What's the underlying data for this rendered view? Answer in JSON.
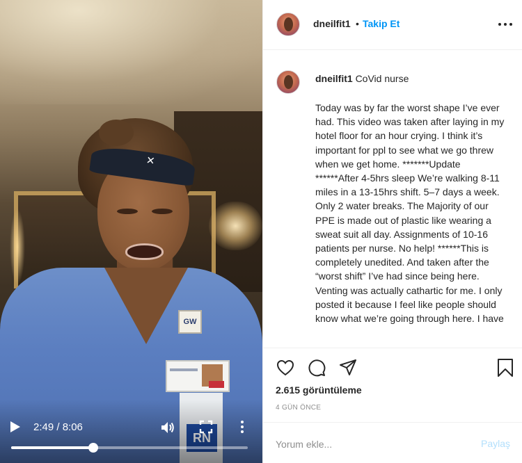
{
  "video": {
    "headband_logo": "✕",
    "lanyard_clip_text": "GW",
    "badge_tag_text": "RN",
    "time_display": "2:49 / 8:06",
    "progress_fraction": 0.348
  },
  "header": {
    "username": "dneilfit1",
    "separator": "•",
    "follow_label": "Takip Et"
  },
  "caption": {
    "username": "dneilfit1",
    "short_text": "CoVid nurse",
    "body": "Today was by far the worst shape I’ve ever had. This video was taken after laying in my hotel floor for an hour crying. I think it’s important for ppl to see what we go threw when we get home. *******Update ******After 4-5hrs sleep We’re walking 8-11 miles in a 13-15hrs shift. 5–7 days a week. Only 2 water breaks. The Majority of our PPE is made out of plastic like wearing a sweat suit all day. Assignments of 10-16 patients per nurse. No help! ******This is completely unedited. And taken after the “worst shift” I’ve had since being here. Venting was actually cathartic for me. I only posted it because I feel like people should know what we’re going through here. I have"
  },
  "stats": {
    "views": "2.615 görüntüleme",
    "age": "4 GÜN ÖNCE"
  },
  "comment_box": {
    "placeholder": "Yorum ekle...",
    "post_label": "Paylaş"
  },
  "colors": {
    "link_blue": "#0095f6",
    "post_disabled": "#b2dffc",
    "muted_text": "#8e8e8e",
    "scrubs_blue": "#5b7ec0"
  },
  "icons": [
    "play-icon",
    "volume-icon",
    "fullscreen-icon",
    "more-vertical-icon",
    "more-horizontal-icon",
    "heart-icon",
    "comment-icon",
    "share-icon",
    "bookmark-icon"
  ]
}
